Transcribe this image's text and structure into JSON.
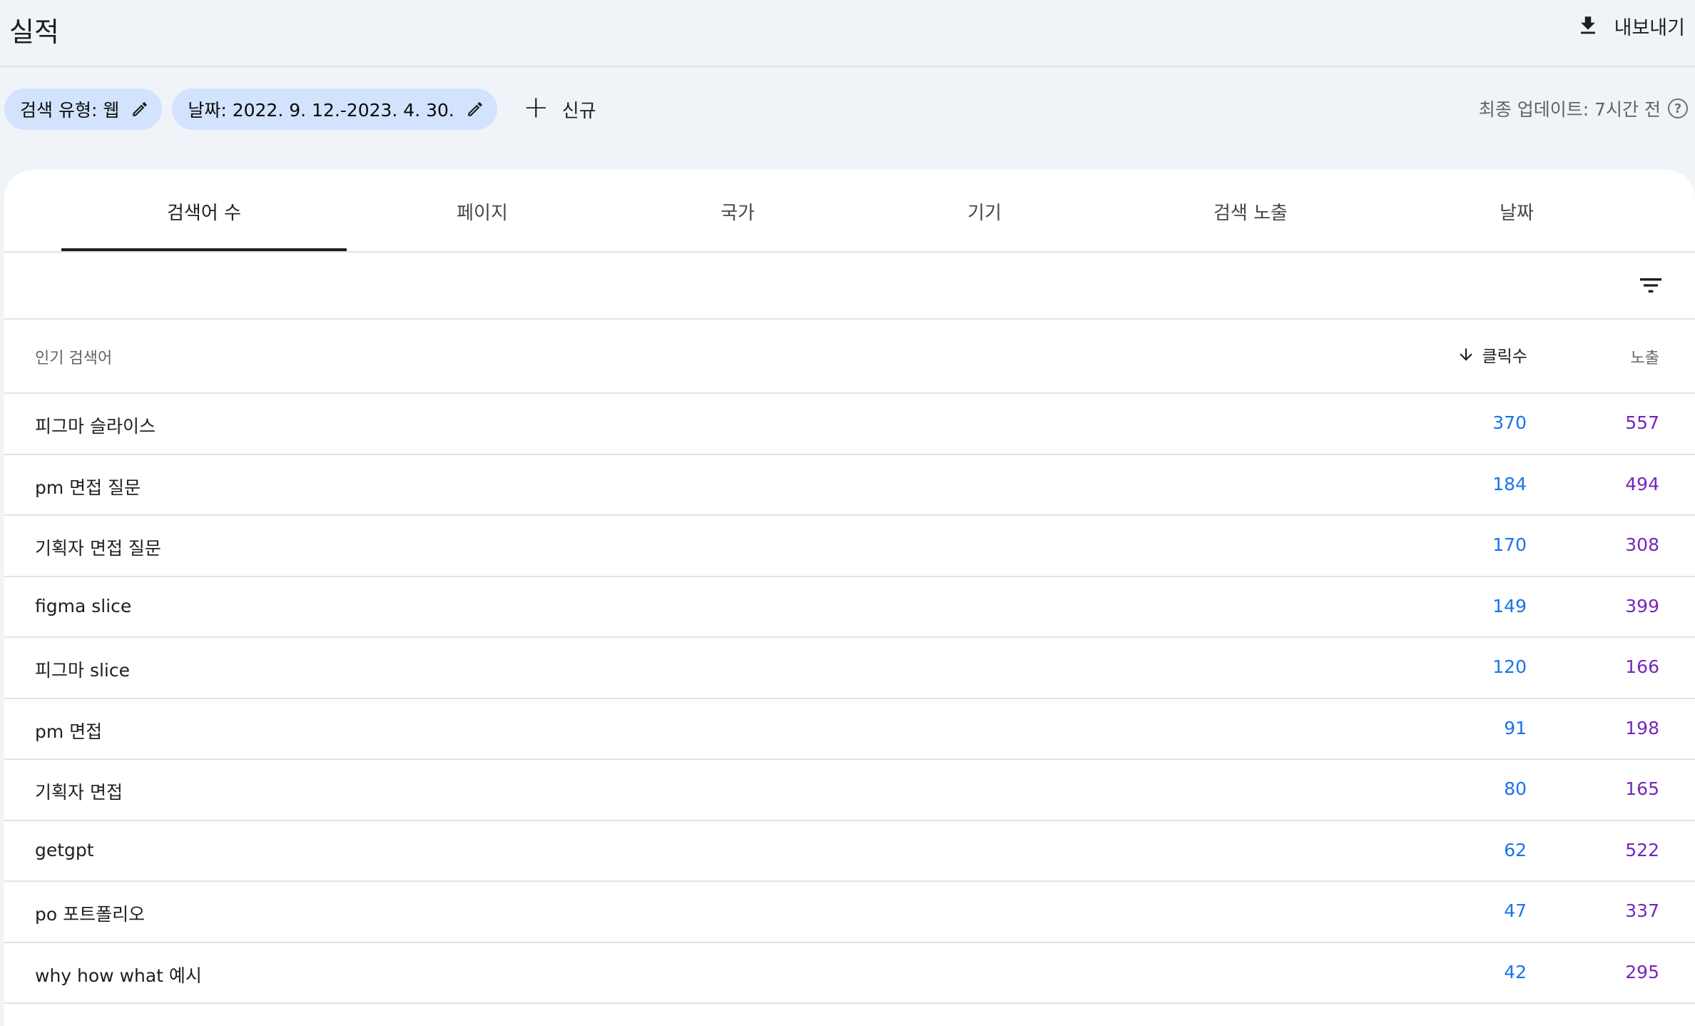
{
  "header": {
    "title": "실적",
    "export_label": "내보내기"
  },
  "filters": {
    "search_type": "검색 유형: 웹",
    "date_range": "날짜: 2022. 9. 12.-2023. 4. 30.",
    "add_new": "신규",
    "last_updated": "최종 업데이트: 7시간 전"
  },
  "tabs": [
    {
      "label": "검색어 수",
      "active": true
    },
    {
      "label": "페이지",
      "active": false
    },
    {
      "label": "국가",
      "active": false
    },
    {
      "label": "기기",
      "active": false
    },
    {
      "label": "검색 노출",
      "active": false
    },
    {
      "label": "날짜",
      "active": false
    }
  ],
  "table": {
    "columns": {
      "query": "인기 검색어",
      "clicks": "클릭수",
      "impressions": "노출"
    },
    "rows": [
      {
        "query": "피그마 슬라이스",
        "clicks": "370",
        "impressions": "557"
      },
      {
        "query": "pm 면접 질문",
        "clicks": "184",
        "impressions": "494"
      },
      {
        "query": "기획자 면접 질문",
        "clicks": "170",
        "impressions": "308"
      },
      {
        "query": "figma slice",
        "clicks": "149",
        "impressions": "399"
      },
      {
        "query": "피그마 slice",
        "clicks": "120",
        "impressions": "166"
      },
      {
        "query": "pm 면접",
        "clicks": "91",
        "impressions": "198"
      },
      {
        "query": "기획자 면접",
        "clicks": "80",
        "impressions": "165"
      },
      {
        "query": "getgpt",
        "clicks": "62",
        "impressions": "522"
      },
      {
        "query": "po 포트폴리오",
        "clicks": "47",
        "impressions": "337"
      },
      {
        "query": "why how what 예시",
        "clicks": "42",
        "impressions": "295"
      }
    ]
  },
  "colors": {
    "background": "#f0f4f9",
    "chip": "#d3e3fd",
    "clicks": "#1a73e8",
    "impressions": "#7627bb"
  },
  "icons": [
    "download-icon",
    "edit-icon",
    "plus-icon",
    "help-icon",
    "filter-icon",
    "arrow-down-icon"
  ]
}
